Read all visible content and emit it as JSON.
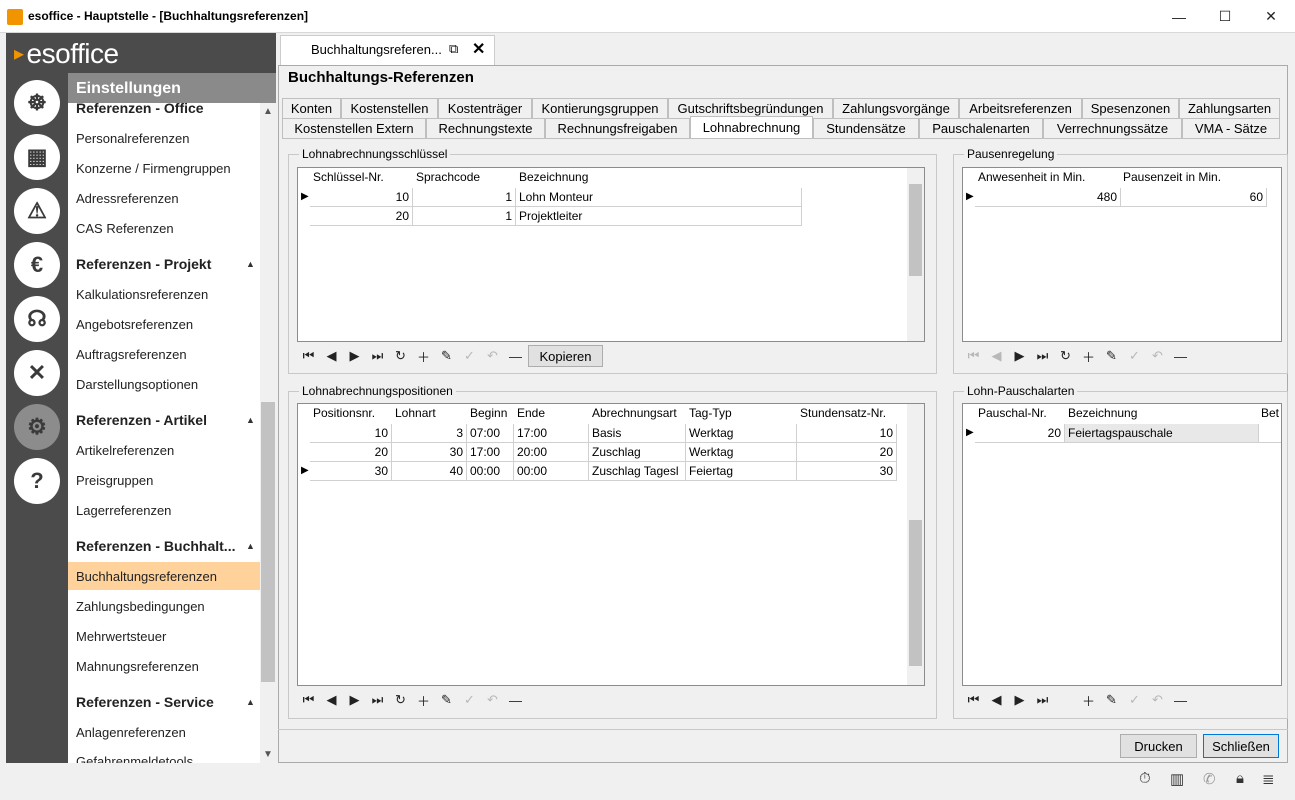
{
  "window": {
    "title": "esoffice - Hauptstelle - [Buchhaltungsreferenzen]",
    "minimize": "—",
    "maximize": "☐",
    "close": "✕"
  },
  "logo": "esoffice",
  "nav": {
    "header": "Einstellungen",
    "groups": [
      {
        "title": "Referenzen - Office",
        "items": [
          "Personalreferenzen",
          "Konzerne / Firmengruppen",
          "Adressreferenzen",
          "CAS Referenzen"
        ]
      },
      {
        "title": "Referenzen - Projekt",
        "items": [
          "Kalkulationsreferenzen",
          "Angebotsreferenzen",
          "Auftragsreferenzen",
          "Darstellungsoptionen"
        ]
      },
      {
        "title": "Referenzen - Artikel",
        "items": [
          "Artikelreferenzen",
          "Preisgruppen",
          "Lagerreferenzen"
        ]
      },
      {
        "title": "Referenzen - Buchhalt...",
        "items": [
          "Buchhaltungsreferenzen",
          "Zahlungsbedingungen",
          "Mehrwertsteuer",
          "Mahnungsreferenzen"
        ]
      },
      {
        "title": "Referenzen - Service",
        "items": [
          "Anlagenreferenzen",
          "Gefahrenmeldetools"
        ]
      }
    ],
    "active_item": "Buchhaltungsreferenzen"
  },
  "doc_tab": {
    "label": "Buchhaltungsreferen..."
  },
  "page_title": "Buchhaltungs-Referenzen",
  "tabs_row1": [
    "Konten",
    "Kostenstellen",
    "Kostenträger",
    "Kontierungsgruppen",
    "Gutschriftsbegründungen",
    "Zahlungsvorgänge",
    "Arbeitsreferenzen",
    "Spesenzonen",
    "Zahlungsarten"
  ],
  "tabs_row2": [
    "Kostenstellen Extern",
    "Rechnungstexte",
    "Rechnungsfreigaben",
    "Lohnabrechnung",
    "Stundensätze",
    "Pauschalenarten",
    "Verrechnungssätze",
    "VMA - Sätze"
  ],
  "selected_tab": "Lohnabrechnung",
  "schluessel": {
    "title": "Lohnabrechnungsschlüssel",
    "columns": [
      "Schlüssel-Nr.",
      "Sprachcode",
      "Bezeichnung"
    ],
    "rows": [
      [
        "10",
        "1",
        "Lohn Monteur"
      ],
      [
        "20",
        "1",
        "Projektleiter"
      ]
    ],
    "copy_button": "Kopieren"
  },
  "pause": {
    "title": "Pausenregelung",
    "columns": [
      "Anwesenheit in Min.",
      "Pausenzeit in Min."
    ],
    "rows": [
      [
        "480",
        "60"
      ]
    ]
  },
  "positionen": {
    "title": "Lohnabrechnungspositionen",
    "columns": [
      "Positionsnr.",
      "Lohnart",
      "Beginn",
      "Ende",
      "Abrechnungsart",
      "Tag-Typ",
      "Stundensatz-Nr."
    ],
    "rows": [
      [
        "10",
        "3",
        "07:00",
        "17:00",
        "Basis",
        "Werktag",
        "10"
      ],
      [
        "20",
        "30",
        "17:00",
        "20:00",
        "Zuschlag",
        "Werktag",
        "20"
      ],
      [
        "30",
        "40",
        "00:00",
        "00:00",
        "Zuschlag Tagesl",
        "Feiertag",
        "30"
      ]
    ]
  },
  "pauschal": {
    "title": "Lohn-Pauschalarten",
    "columns": [
      "Pauschal-Nr.",
      "Bezeichnung",
      "Bet"
    ],
    "rows": [
      [
        "20",
        "Feiertagspauschale",
        ""
      ]
    ]
  },
  "buttons": {
    "print": "Drucken",
    "close": "Schließen"
  }
}
